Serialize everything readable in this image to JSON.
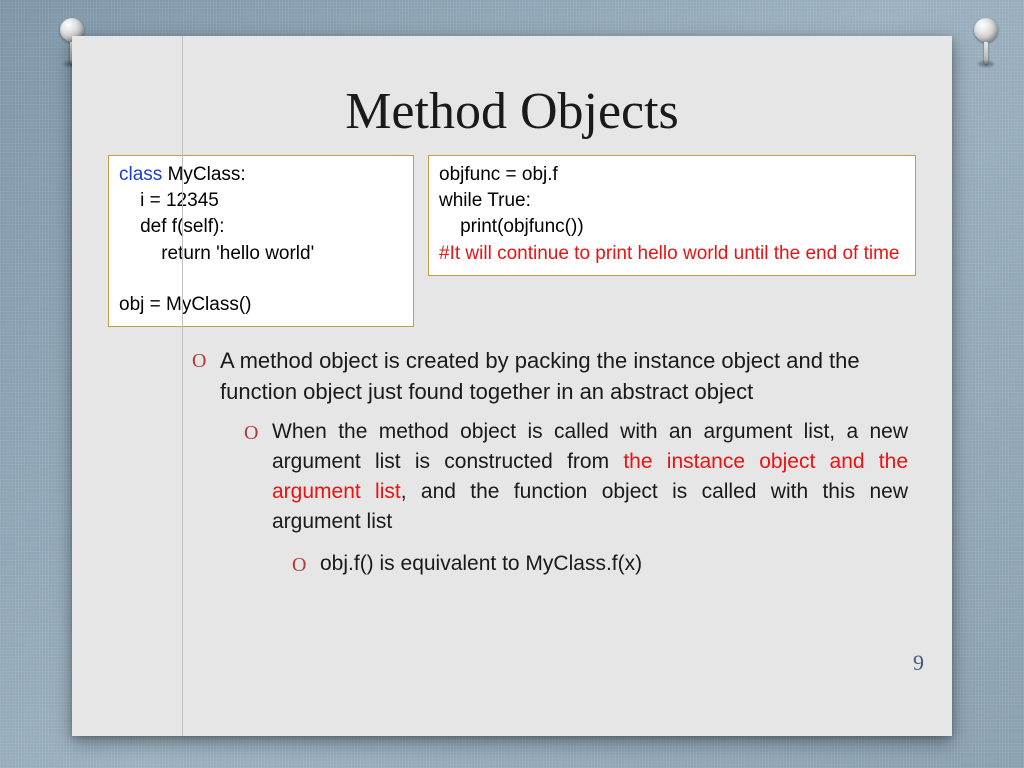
{
  "title": "Method Objects",
  "code_left": {
    "l1a": "class",
    "l1b": " MyClass:",
    "l2": "    i = 12345",
    "l3": "    def f(self):",
    "l4": "        return 'hello world'",
    "l5": "",
    "l6": "obj = MyClass()"
  },
  "code_right": {
    "l1": "objfunc = obj.f",
    "l2": "while True:",
    "l3": "    print(objfunc())",
    "l4": "#It will continue to print hello world until the end of time"
  },
  "bullets": {
    "b1": "A method object is created by packing the instance object and the function object just found together in an abstract object",
    "b2a": "When the method object is called with an argument list, a new argument list is constructed from ",
    "b2h": "the instance object and the argument list",
    "b2b": ", and the function object is called with this new argument list",
    "b3": "obj.f() is equivalent to MyClass.f(x)"
  },
  "page_number": "9"
}
